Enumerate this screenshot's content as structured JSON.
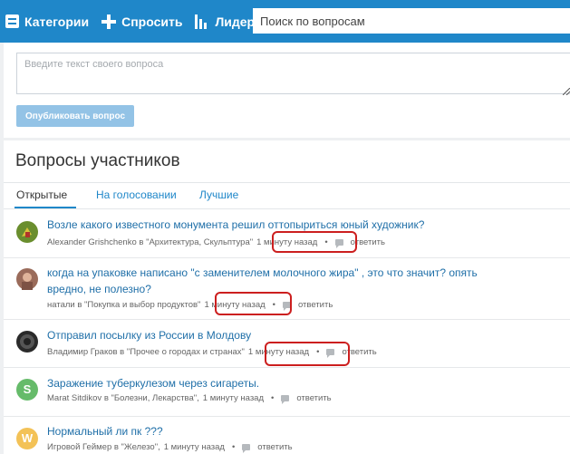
{
  "nav": {
    "categories": "Категории",
    "ask": "Спросить",
    "leaders": "Лидеры",
    "search_placeholder": "Поиск по вопросам"
  },
  "ask_form": {
    "placeholder": "Введите текст своего вопроса",
    "publish_label": "Опубликовать вопрос"
  },
  "questions": {
    "title": "Вопросы участников",
    "tabs": [
      "Открытые",
      "На голосовании",
      "Лучшие"
    ],
    "active_tab": "Открытые",
    "reply_label": "ответить",
    "items": [
      {
        "text": "Возле какого известного монумента решил оттопыриться юный художник?",
        "author": "Alexander Grishchenko в \"Архитектура, Скульптура\"",
        "time": "1 минуту назад",
        "avatar_color": "#6a8e2e"
      },
      {
        "text": "когда на упаковке написано \"с заменителем молочного жира\" , это что значит? опять вредно, не полезно?",
        "author": "натали в \"Покупка и выбор продуктов\"",
        "time": "1 минуту назад",
        "avatar_color": "#9a6b5a"
      },
      {
        "text": "Отправил посылку из России в Молдову",
        "author": "Владимир Граков в \"Прочее о городах и странах\"",
        "time": "1 минуту назад",
        "avatar_color": "#2a2a2a"
      },
      {
        "text": "Заражение туберкулезом через сигареты.",
        "author": "Marat Sitdikov в \"Болезни, Лекарства\",",
        "time": "1 минуту назад",
        "avatar_letter": "S",
        "avatar_color": "#66bb6a"
      },
      {
        "text": "Нормальный ли пк ???",
        "author": "Игровой Геймер в \"Железо\",",
        "time": "1 минуту назад",
        "avatar_letter": "W",
        "avatar_color": "#f3c257"
      }
    ]
  },
  "colors": {
    "brand": "#1f87c9",
    "link": "#1f6fa8",
    "annotation": "#cc1f1f"
  }
}
